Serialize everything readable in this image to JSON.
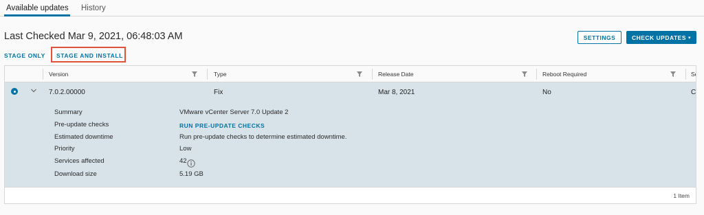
{
  "tabs": [
    {
      "label": "Available updates",
      "active": true
    },
    {
      "label": "History",
      "active": false
    }
  ],
  "header": {
    "last_checked": "Last Checked Mar 9, 2021, 06:48:03 AM",
    "settings_label": "SETTINGS",
    "check_updates_label": "CHECK UPDATES",
    "check_updates_caret": "▾"
  },
  "actions": {
    "stage_only": "STAGE ONLY",
    "stage_and_install": "STAGE AND INSTALL",
    "highlight_color": "#e0513b"
  },
  "grid": {
    "columns": [
      "Version",
      "Type",
      "Release Date",
      "Reboot Required",
      "Se"
    ],
    "row": {
      "selected": true,
      "version": "7.0.2.00000",
      "type": "Fix",
      "release_date": "Mar 8, 2021",
      "reboot_required": "No",
      "next_col_partial": "C"
    },
    "details": [
      {
        "label": "Summary",
        "value": "VMware vCenter Server 7.0 Update 2"
      },
      {
        "label": "Pre-update checks",
        "value": "RUN PRE-UPDATE CHECKS",
        "is_link": true
      },
      {
        "label": "Estimated downtime",
        "value": "Run pre-update checks to determine estimated downtime."
      },
      {
        "label": "Priority",
        "value": "Low"
      },
      {
        "label": "Services affected",
        "value": "42",
        "icon": "info-icon"
      },
      {
        "label": "Download size",
        "value": "5.19 GB"
      }
    ],
    "footer": "1 Item"
  },
  "colors": {
    "accent": "#0072a3",
    "selected_row": "#d8e3e9"
  }
}
